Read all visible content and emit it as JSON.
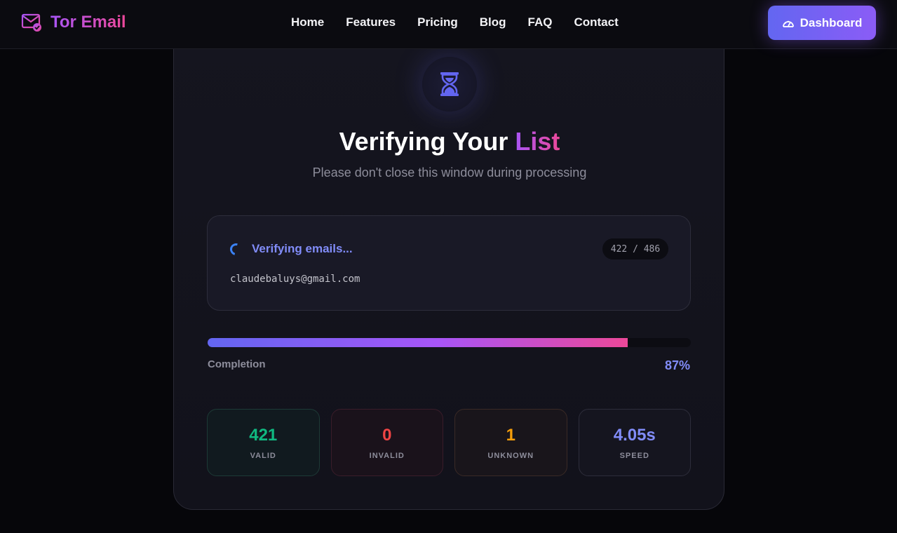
{
  "nav": {
    "brand": "Tor Email",
    "links": [
      "Home",
      "Features",
      "Pricing",
      "Blog",
      "FAQ",
      "Contact"
    ],
    "dashboard_label": "Dashboard"
  },
  "main": {
    "title_prefix": "Verifying Your",
    "title_accent": "List",
    "subtitle": "Please don't close this window during processing",
    "status": {
      "label": "Verifying emails...",
      "count": "422 / 486",
      "current_email": "claudebaluys@gmail.com"
    },
    "progress": {
      "label": "Completion",
      "value_text": "87%",
      "fraction": 0.87
    },
    "stats": [
      {
        "value": "421",
        "label": "VALID",
        "color": "#10b981"
      },
      {
        "value": "0",
        "label": "INVALID",
        "color": "#ef4444"
      },
      {
        "value": "1",
        "label": "UNKNOWN",
        "color": "#f59e0b"
      },
      {
        "value": "4.05s",
        "label": "SPEED",
        "color": "#818cf8"
      }
    ]
  },
  "colors": {
    "accent": "#6366f1",
    "brand_gradient_start": "#a855f7",
    "brand_gradient_end": "#ec4899"
  }
}
